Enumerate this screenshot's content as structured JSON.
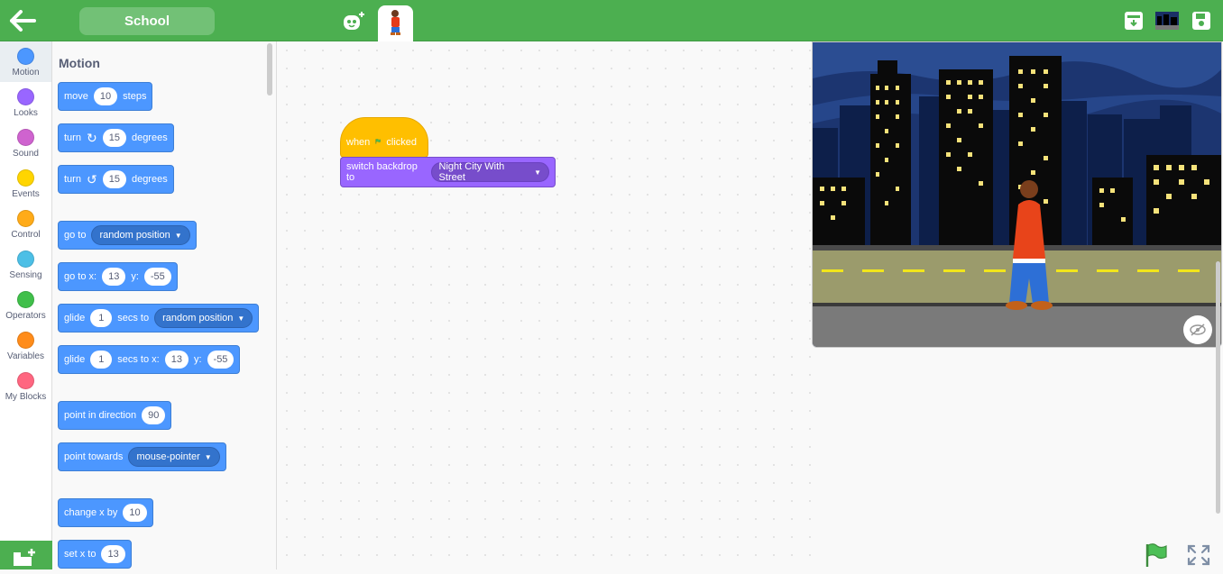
{
  "project": {
    "name": "School"
  },
  "categories": [
    {
      "label": "Motion",
      "color": "#4c97ff"
    },
    {
      "label": "Looks",
      "color": "#9966ff"
    },
    {
      "label": "Sound",
      "color": "#cf63cf"
    },
    {
      "label": "Events",
      "color": "#ffd500"
    },
    {
      "label": "Control",
      "color": "#ffab19"
    },
    {
      "label": "Sensing",
      "color": "#4cbfe6"
    },
    {
      "label": "Operators",
      "color": "#40bf4a"
    },
    {
      "label": "Variables",
      "color": "#ff8c1a"
    },
    {
      "label": "My Blocks",
      "color": "#ff6680"
    }
  ],
  "palette": {
    "heading": "Motion",
    "move": {
      "label": "move",
      "value": "10",
      "suffix": "steps"
    },
    "turn_right": {
      "label": "turn",
      "value": "15",
      "suffix": "degrees"
    },
    "turn_left": {
      "label": "turn",
      "value": "15",
      "suffix": "degrees"
    },
    "go_to": {
      "label": "go to",
      "option": "random position"
    },
    "go_to_xy": {
      "label": "go to x:",
      "x": "13",
      "ylabel": "y:",
      "y": "-55"
    },
    "glide_to": {
      "label": "glide",
      "secs": "1",
      "mid": "secs to",
      "option": "random position"
    },
    "glide_xy": {
      "label": "glide",
      "secs": "1",
      "mid": "secs to x:",
      "x": "13",
      "ylabel": "y:",
      "y": "-55"
    },
    "point_dir": {
      "label": "point in direction",
      "value": "90"
    },
    "point_towards": {
      "label": "point towards",
      "option": "mouse-pointer"
    },
    "change_x": {
      "label": "change x by",
      "value": "10"
    },
    "set_x": {
      "label": "set x to",
      "value": "13"
    }
  },
  "script": {
    "hat": {
      "label": "when",
      "suffix": "clicked"
    },
    "switch_backdrop": {
      "label": "switch backdrop to",
      "option": "Night City With Street"
    }
  },
  "colors": {
    "topbar": "#4caf50",
    "motion": "#4c97ff",
    "events": "#ffbf00",
    "looks": "#9966ff"
  }
}
